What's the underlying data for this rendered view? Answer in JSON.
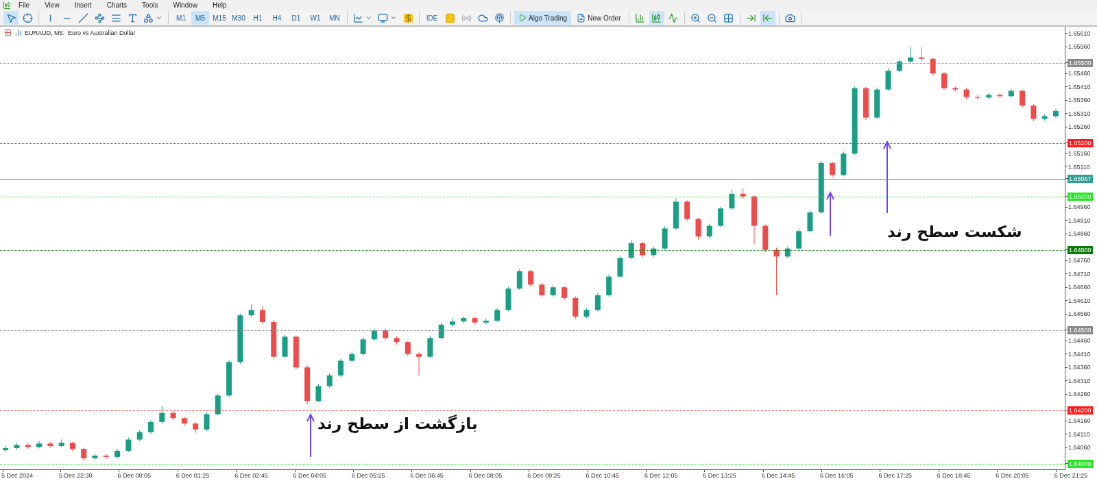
{
  "menu": [
    "File",
    "View",
    "Insert",
    "Charts",
    "Tools",
    "Window",
    "Help"
  ],
  "toolbar": {
    "drawing_tools": [
      {
        "selected": true
      },
      {
        "selected": false
      },
      {
        "selected": false
      },
      {
        "selected": false
      },
      {
        "selected": false
      },
      {
        "selected": false
      },
      {
        "selected": false
      },
      {
        "selected": false
      },
      {
        "selected": false
      }
    ],
    "timeframes": [
      {
        "label": "M1",
        "selected": false
      },
      {
        "label": "M5",
        "selected": true
      },
      {
        "label": "M15",
        "selected": false
      },
      {
        "label": "M30",
        "selected": false
      },
      {
        "label": "H1",
        "selected": false
      },
      {
        "label": "H4",
        "selected": false
      },
      {
        "label": "D1",
        "selected": false
      },
      {
        "label": "W1",
        "selected": false
      },
      {
        "label": "MN",
        "selected": false
      }
    ],
    "ide_label": "IDE",
    "buttons": [
      {
        "label": "Algo Trading",
        "selected": true
      },
      {
        "label": "New Order",
        "selected": false
      }
    ],
    "chart_types": [
      {
        "selected": false
      },
      {
        "selected": true
      },
      {
        "selected": false
      }
    ],
    "view_tools": [
      {
        "selected": false
      },
      {
        "selected": false
      },
      {
        "selected": false
      },
      {
        "selected": false
      },
      {
        "selected": true
      }
    ]
  },
  "chart": {
    "title": "EURAUD, M5:  Euro vs Australian Dollar",
    "time_axis": [
      "5 Dec 2024",
      "5 Dec 22:30",
      "6 Dec 00:05",
      "6 Dec 01:25",
      "6 Dec 02:45",
      "6 Dec 04:05",
      "6 Dec 05:25",
      "6 Dec 06:45",
      "6 Dec 08:05",
      "6 Dec 09:25",
      "6 Dec 10:45",
      "6 Dec 12:05",
      "6 Dec 13:25",
      "6 Dec 14:45",
      "6 Dec 16:05",
      "6 Dec 17:25",
      "6 Dec 18:45",
      "6 Dec 20:05",
      "6 Dec 21:25"
    ],
    "annotations": [
      {
        "text": "شکست سطح رند"
      },
      {
        "text": "بازگشت از سطح رند"
      }
    ],
    "chart_data": {
      "type": "candlestick",
      "ylim": [
        1.63985,
        1.65635
      ],
      "yticks": [
        {
          "value": 1.6561,
          "label": "1.65610"
        },
        {
          "value": 1.6556,
          "label": "1.65560"
        },
        {
          "value": 1.6546,
          "label": "1.65460"
        },
        {
          "value": 1.6541,
          "label": "1.65410"
        },
        {
          "value": 1.6536,
          "label": "1.65360"
        },
        {
          "value": 1.6531,
          "label": "1.65310"
        },
        {
          "value": 1.6526,
          "label": "1.65260"
        },
        {
          "value": 1.6516,
          "label": "1.65160"
        },
        {
          "value": 1.6511,
          "label": "1.65110"
        },
        {
          "value": 1.6496,
          "label": "1.64960"
        },
        {
          "value": 1.6491,
          "label": "1.64910"
        },
        {
          "value": 1.6486,
          "label": "1.64860"
        },
        {
          "value": 1.6476,
          "label": "1.64760"
        },
        {
          "value": 1.6471,
          "label": "1.64710"
        },
        {
          "value": 1.6466,
          "label": "1.64660"
        },
        {
          "value": 1.6461,
          "label": "1.64610"
        },
        {
          "value": 1.6456,
          "label": "1.64560"
        },
        {
          "value": 1.6446,
          "label": "1.64460"
        },
        {
          "value": 1.6441,
          "label": "1.64410"
        },
        {
          "value": 1.6436,
          "label": "1.64360"
        },
        {
          "value": 1.6431,
          "label": "1.64310"
        },
        {
          "value": 1.6426,
          "label": "1.64260"
        },
        {
          "value": 1.6416,
          "label": "1.64160"
        },
        {
          "value": 1.6411,
          "label": "1.64110"
        },
        {
          "value": 1.6406,
          "label": "1.64060"
        }
      ],
      "ref_lines": [
        {
          "axis": "y",
          "value": 1.655,
          "label": "1.65500",
          "color": "#8a8a8a"
        },
        {
          "axis": "y",
          "value": 1.652,
          "label": "1.65200",
          "color": "#ff1a1a"
        },
        {
          "axis": "y",
          "value": 1.65067,
          "label": "1.65067",
          "color": "#2e9c92"
        },
        {
          "axis": "y",
          "value": 1.65,
          "label": "1.65000",
          "color": "#22e622"
        },
        {
          "axis": "y",
          "value": 1.648,
          "label": "1.64800",
          "color": "#0a7a0a"
        },
        {
          "axis": "y",
          "value": 1.645,
          "label": "1.64500",
          "color": "#8a8a8a"
        },
        {
          "axis": "y",
          "value": 1.642,
          "label": "1.64200",
          "color": "#ff1a1a"
        },
        {
          "axis": "y",
          "value": 1.64,
          "label": "1.64000",
          "color": "#22e622"
        }
      ],
      "categories": [
        null,
        null,
        null,
        null,
        null,
        null,
        null,
        null,
        null,
        null,
        null,
        null,
        null,
        null,
        null,
        null,
        null,
        null,
        null,
        null,
        null,
        null,
        null,
        null,
        null,
        null,
        null,
        null,
        null,
        null,
        null,
        null,
        null,
        null,
        null,
        null,
        null,
        null,
        null,
        null,
        null,
        null,
        null,
        null,
        null,
        null,
        null,
        null,
        null,
        null,
        null,
        null,
        null,
        null,
        null,
        null,
        null,
        null,
        null,
        null,
        null,
        null,
        null,
        null,
        null,
        null,
        null,
        null,
        null,
        null,
        null,
        null,
        null,
        null,
        null,
        null,
        null,
        null,
        null,
        null,
        null,
        null,
        null,
        null,
        null,
        null,
        null,
        null,
        null,
        null,
        null,
        null,
        null,
        null,
        null
      ],
      "ohlc": [
        [
          1.6405,
          1.64066,
          1.64044,
          1.64058
        ],
        [
          1.64058,
          1.64078,
          1.64052,
          1.6407
        ],
        [
          1.6407,
          1.64079,
          1.64055,
          1.64062
        ],
        [
          1.64062,
          1.64084,
          1.64057,
          1.64075
        ],
        [
          1.64075,
          1.64081,
          1.6406,
          1.64066
        ],
        [
          1.64066,
          1.6409,
          1.64062,
          1.64078
        ],
        [
          1.64078,
          1.64082,
          1.64048,
          1.64055
        ],
        [
          1.64055,
          1.6406,
          1.6401,
          1.6402
        ],
        [
          1.6402,
          1.64038,
          1.64015,
          1.6403
        ],
        [
          1.6403,
          1.64036,
          1.64018,
          1.64025
        ],
        [
          1.64025,
          1.64055,
          1.6402,
          1.64048
        ],
        [
          1.64048,
          1.64098,
          1.64044,
          1.6409
        ],
        [
          1.6409,
          1.64126,
          1.64084,
          1.64118
        ],
        [
          1.64118,
          1.64162,
          1.64112,
          1.64156
        ],
        [
          1.64156,
          1.64215,
          1.6415,
          1.6419
        ],
        [
          1.6419,
          1.64198,
          1.64162,
          1.6417
        ],
        [
          1.6417,
          1.64176,
          1.6414,
          1.6415
        ],
        [
          1.6415,
          1.64155,
          1.64115,
          1.64128
        ],
        [
          1.64128,
          1.64192,
          1.64122,
          1.64185
        ],
        [
          1.64185,
          1.64262,
          1.6418,
          1.64255
        ],
        [
          1.64255,
          1.64388,
          1.6425,
          1.6438
        ],
        [
          1.6438,
          1.64562,
          1.64372,
          1.64555
        ],
        [
          1.64555,
          1.64595,
          1.64548,
          1.64575
        ],
        [
          1.64575,
          1.64588,
          1.64522,
          1.6453
        ],
        [
          1.6453,
          1.64538,
          1.64392,
          1.644
        ],
        [
          1.644,
          1.64482,
          1.64395,
          1.64475
        ],
        [
          1.64475,
          1.6448,
          1.64352,
          1.6436
        ],
        [
          1.6436,
          1.64368,
          1.64222,
          1.64235
        ],
        [
          1.64235,
          1.64298,
          1.6423,
          1.6429
        ],
        [
          1.6429,
          1.64338,
          1.64284,
          1.6433
        ],
        [
          1.6433,
          1.64392,
          1.64325,
          1.64385
        ],
        [
          1.64385,
          1.6442,
          1.64378,
          1.6441
        ],
        [
          1.6441,
          1.64472,
          1.64405,
          1.64465
        ],
        [
          1.64465,
          1.64506,
          1.6446,
          1.64498
        ],
        [
          1.64498,
          1.64505,
          1.64462,
          1.6447
        ],
        [
          1.6447,
          1.64478,
          1.64446,
          1.64455
        ],
        [
          1.64455,
          1.6446,
          1.64402,
          1.6441
        ],
        [
          1.6441,
          1.64418,
          1.6433,
          1.644
        ],
        [
          1.644,
          1.64478,
          1.64395,
          1.6447
        ],
        [
          1.6447,
          1.64528,
          1.64465,
          1.6452
        ],
        [
          1.6452,
          1.64545,
          1.64512,
          1.64532
        ],
        [
          1.64532,
          1.64552,
          1.64526,
          1.64545
        ],
        [
          1.64545,
          1.6455,
          1.6452,
          1.64528
        ],
        [
          1.64528,
          1.64542,
          1.6452,
          1.64535
        ],
        [
          1.64535,
          1.64582,
          1.6453,
          1.64575
        ],
        [
          1.64575,
          1.64662,
          1.6457,
          1.64655
        ],
        [
          1.64655,
          1.64728,
          1.6465,
          1.6472
        ],
        [
          1.6472,
          1.64725,
          1.64662,
          1.6467
        ],
        [
          1.6467,
          1.64676,
          1.64622,
          1.6463
        ],
        [
          1.6463,
          1.64668,
          1.64625,
          1.6466
        ],
        [
          1.6466,
          1.64665,
          1.64612,
          1.6462
        ],
        [
          1.6462,
          1.64626,
          1.6454,
          1.6455
        ],
        [
          1.6455,
          1.64582,
          1.64544,
          1.64575
        ],
        [
          1.64575,
          1.64638,
          1.6457,
          1.6463
        ],
        [
          1.6463,
          1.64708,
          1.64625,
          1.647
        ],
        [
          1.647,
          1.64778,
          1.64695,
          1.6477
        ],
        [
          1.6477,
          1.64838,
          1.64765,
          1.64825
        ],
        [
          1.64825,
          1.6483,
          1.64772,
          1.6478
        ],
        [
          1.6478,
          1.64812,
          1.64774,
          1.64805
        ],
        [
          1.64805,
          1.64888,
          1.648,
          1.6488
        ],
        [
          1.6488,
          1.64992,
          1.64875,
          1.6498
        ],
        [
          1.6498,
          1.64986,
          1.64908,
          1.64915
        ],
        [
          1.64915,
          1.6492,
          1.64838,
          1.6485
        ],
        [
          1.6485,
          1.64898,
          1.64845,
          1.6489
        ],
        [
          1.6489,
          1.64962,
          1.64884,
          1.64955
        ],
        [
          1.64955,
          1.65025,
          1.6495,
          1.6501
        ],
        [
          1.6501,
          1.6503,
          1.64992,
          1.65
        ],
        [
          1.65,
          1.65005,
          1.6482,
          1.6489
        ],
        [
          1.6489,
          1.64895,
          1.64792,
          1.648
        ],
        [
          1.648,
          1.64808,
          1.6463,
          1.64775
        ],
        [
          1.64775,
          1.64812,
          1.64768,
          1.64805
        ],
        [
          1.64805,
          1.64878,
          1.648,
          1.6487
        ],
        [
          1.6487,
          1.64948,
          1.64865,
          1.6494
        ],
        [
          1.6494,
          1.65132,
          1.64935,
          1.65125
        ],
        [
          1.65125,
          1.6513,
          1.65072,
          1.6508
        ],
        [
          1.6508,
          1.65168,
          1.65075,
          1.6516
        ],
        [
          1.6516,
          1.65412,
          1.65155,
          1.65405
        ],
        [
          1.65405,
          1.6541,
          1.65285,
          1.65295
        ],
        [
          1.65295,
          1.65408,
          1.6529,
          1.654
        ],
        [
          1.654,
          1.65478,
          1.65395,
          1.6547
        ],
        [
          1.6547,
          1.65512,
          1.65465,
          1.65505
        ],
        [
          1.65505,
          1.6556,
          1.65498,
          1.6552
        ],
        [
          1.6552,
          1.6556,
          1.65508,
          1.65515
        ],
        [
          1.65515,
          1.6552,
          1.65452,
          1.6546
        ],
        [
          1.6546,
          1.65466,
          1.65398,
          1.65405
        ],
        [
          1.65405,
          1.65412,
          1.65392,
          1.654
        ],
        [
          1.654,
          1.65406,
          1.65364,
          1.65372
        ],
        [
          1.65372,
          1.65378,
          1.65362,
          1.6537
        ],
        [
          1.6537,
          1.65388,
          1.65364,
          1.6538
        ],
        [
          1.6538,
          1.65386,
          1.65368,
          1.65375
        ],
        [
          1.65375,
          1.65402,
          1.6537,
          1.65395
        ],
        [
          1.65395,
          1.654,
          1.65332,
          1.6534
        ],
        [
          1.6534,
          1.65346,
          1.65282,
          1.6529
        ],
        [
          1.6529,
          1.65308,
          1.65284,
          1.653
        ],
        [
          1.653,
          1.65328,
          1.65294,
          1.6532
        ]
      ]
    }
  }
}
